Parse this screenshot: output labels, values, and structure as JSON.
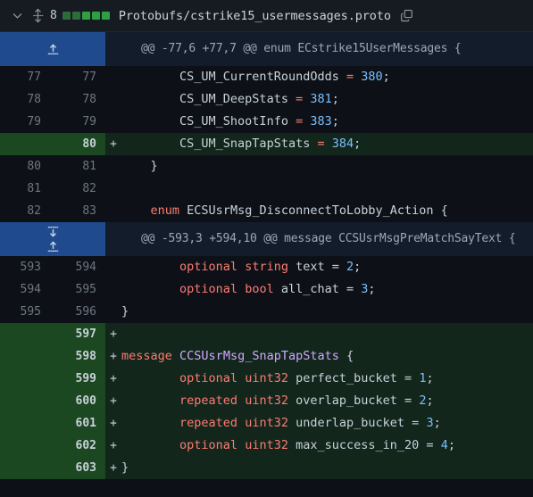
{
  "header": {
    "chevron_icon": "chevron-down-icon",
    "drag_icon": "drag-handle-icon",
    "change_count": "8",
    "diffstat_blocks": [
      "faded",
      "faded",
      "solid",
      "solid",
      "solid"
    ],
    "file_path": "Protobufs/cstrike15_usermessages.proto",
    "copy_icon": "copy-icon"
  },
  "colors": {
    "background": "#0d1117",
    "header_background": "#161b22",
    "added_gutter": "#1b4721",
    "added_code": "#12261c",
    "expander_gutter": "#1f4b8e",
    "expander_code": "#131c2b",
    "keyword": "#ff7b72",
    "number": "#79c0ff",
    "type": "#d2a8ff",
    "text": "#c9d1d9",
    "line_number": "#6e7681",
    "diffstat_added": "#2ea043"
  },
  "rows": [
    {
      "kind": "expander",
      "name": "expand-up",
      "icons": [
        "arrow-up-icon"
      ],
      "old_line": "",
      "new_line": "",
      "marker": "",
      "hunk_text": "@@ -77,6 +77,7 @@ enum ECstrike15UserMessages {"
    },
    {
      "kind": "ctx",
      "old_line": "77",
      "new_line": "77",
      "marker": "",
      "tokens": [
        {
          "t": "        ",
          "c": "pl"
        },
        {
          "t": "CS_UM_CurrentRoundOdds",
          "c": "id"
        },
        {
          "t": " ",
          "c": "pl"
        },
        {
          "t": "=",
          "c": "op"
        },
        {
          "t": " ",
          "c": "pl"
        },
        {
          "t": "380",
          "c": "num"
        },
        {
          "t": ";",
          "c": "pl"
        }
      ]
    },
    {
      "kind": "ctx",
      "old_line": "78",
      "new_line": "78",
      "marker": "",
      "tokens": [
        {
          "t": "        ",
          "c": "pl"
        },
        {
          "t": "CS_UM_DeepStats",
          "c": "id"
        },
        {
          "t": " ",
          "c": "pl"
        },
        {
          "t": "=",
          "c": "op"
        },
        {
          "t": " ",
          "c": "pl"
        },
        {
          "t": "381",
          "c": "num"
        },
        {
          "t": ";",
          "c": "pl"
        }
      ]
    },
    {
      "kind": "ctx",
      "old_line": "79",
      "new_line": "79",
      "marker": "",
      "tokens": [
        {
          "t": "        ",
          "c": "pl"
        },
        {
          "t": "CS_UM_ShootInfo",
          "c": "id"
        },
        {
          "t": " ",
          "c": "pl"
        },
        {
          "t": "=",
          "c": "op"
        },
        {
          "t": " ",
          "c": "pl"
        },
        {
          "t": "383",
          "c": "num"
        },
        {
          "t": ";",
          "c": "pl"
        }
      ]
    },
    {
      "kind": "add",
      "old_line": "",
      "new_line": "80",
      "marker": "+",
      "tokens": [
        {
          "t": "        ",
          "c": "pl"
        },
        {
          "t": "CS_UM_SnapTapStats",
          "c": "id"
        },
        {
          "t": " ",
          "c": "pl"
        },
        {
          "t": "=",
          "c": "op"
        },
        {
          "t": " ",
          "c": "pl"
        },
        {
          "t": "384",
          "c": "num"
        },
        {
          "t": ";",
          "c": "pl"
        }
      ]
    },
    {
      "kind": "ctx",
      "old_line": "80",
      "new_line": "81",
      "marker": "",
      "tokens": [
        {
          "t": "    }",
          "c": "pl"
        }
      ]
    },
    {
      "kind": "ctx",
      "old_line": "81",
      "new_line": "82",
      "marker": "",
      "tokens": [
        {
          "t": "",
          "c": "pl"
        }
      ]
    },
    {
      "kind": "ctx",
      "old_line": "82",
      "new_line": "83",
      "marker": "",
      "tokens": [
        {
          "t": "    ",
          "c": "pl"
        },
        {
          "t": "enum",
          "c": "kw"
        },
        {
          "t": " ",
          "c": "pl"
        },
        {
          "t": "ECSUsrMsg_DisconnectToLobby_Action",
          "c": "id"
        },
        {
          "t": " {",
          "c": "pl"
        }
      ]
    },
    {
      "kind": "expander",
      "name": "expand-down-up",
      "icons": [
        "arrow-down-icon",
        "arrow-up-icon"
      ],
      "old_line": "",
      "new_line": "",
      "marker": "",
      "hunk_text": "@@ -593,3 +594,10 @@ message CCSUsrMsgPreMatchSayText {"
    },
    {
      "kind": "ctx",
      "old_line": "593",
      "new_line": "594",
      "marker": "",
      "tokens": [
        {
          "t": "        ",
          "c": "pl"
        },
        {
          "t": "optional",
          "c": "kw"
        },
        {
          "t": " ",
          "c": "pl"
        },
        {
          "t": "string",
          "c": "kw"
        },
        {
          "t": " ",
          "c": "pl"
        },
        {
          "t": "text",
          "c": "id"
        },
        {
          "t": " = ",
          "c": "pl"
        },
        {
          "t": "2",
          "c": "num"
        },
        {
          "t": ";",
          "c": "pl"
        }
      ]
    },
    {
      "kind": "ctx",
      "old_line": "594",
      "new_line": "595",
      "marker": "",
      "tokens": [
        {
          "t": "        ",
          "c": "pl"
        },
        {
          "t": "optional",
          "c": "kw"
        },
        {
          "t": " ",
          "c": "pl"
        },
        {
          "t": "bool",
          "c": "kw"
        },
        {
          "t": " ",
          "c": "pl"
        },
        {
          "t": "all_chat",
          "c": "id"
        },
        {
          "t": " = ",
          "c": "pl"
        },
        {
          "t": "3",
          "c": "num"
        },
        {
          "t": ";",
          "c": "pl"
        }
      ]
    },
    {
      "kind": "ctx",
      "old_line": "595",
      "new_line": "596",
      "marker": "",
      "tokens": [
        {
          "t": "}",
          "c": "pl"
        }
      ]
    },
    {
      "kind": "add",
      "old_line": "",
      "new_line": "597",
      "marker": "+",
      "tokens": [
        {
          "t": "",
          "c": "pl"
        }
      ]
    },
    {
      "kind": "add",
      "old_line": "",
      "new_line": "598",
      "marker": "+",
      "tokens": [
        {
          "t": "message",
          "c": "kw"
        },
        {
          "t": " ",
          "c": "pl"
        },
        {
          "t": "CCSUsrMsg_SnapTapStats",
          "c": "type"
        },
        {
          "t": " {",
          "c": "pl"
        }
      ]
    },
    {
      "kind": "add",
      "old_line": "",
      "new_line": "599",
      "marker": "+",
      "tokens": [
        {
          "t": "        ",
          "c": "pl"
        },
        {
          "t": "optional",
          "c": "kw"
        },
        {
          "t": " ",
          "c": "pl"
        },
        {
          "t": "uint32",
          "c": "kw"
        },
        {
          "t": " ",
          "c": "pl"
        },
        {
          "t": "perfect_bucket",
          "c": "id"
        },
        {
          "t": " = ",
          "c": "pl"
        },
        {
          "t": "1",
          "c": "num"
        },
        {
          "t": ";",
          "c": "pl"
        }
      ]
    },
    {
      "kind": "add",
      "old_line": "",
      "new_line": "600",
      "marker": "+",
      "tokens": [
        {
          "t": "        ",
          "c": "pl"
        },
        {
          "t": "repeated",
          "c": "kw"
        },
        {
          "t": " ",
          "c": "pl"
        },
        {
          "t": "uint32",
          "c": "kw"
        },
        {
          "t": " ",
          "c": "pl"
        },
        {
          "t": "overlap_bucket",
          "c": "id"
        },
        {
          "t": " = ",
          "c": "pl"
        },
        {
          "t": "2",
          "c": "num"
        },
        {
          "t": ";",
          "c": "pl"
        }
      ]
    },
    {
      "kind": "add",
      "old_line": "",
      "new_line": "601",
      "marker": "+",
      "tokens": [
        {
          "t": "        ",
          "c": "pl"
        },
        {
          "t": "repeated",
          "c": "kw"
        },
        {
          "t": " ",
          "c": "pl"
        },
        {
          "t": "uint32",
          "c": "kw"
        },
        {
          "t": " ",
          "c": "pl"
        },
        {
          "t": "underlap_bucket",
          "c": "id"
        },
        {
          "t": " = ",
          "c": "pl"
        },
        {
          "t": "3",
          "c": "num"
        },
        {
          "t": ";",
          "c": "pl"
        }
      ]
    },
    {
      "kind": "add",
      "old_line": "",
      "new_line": "602",
      "marker": "+",
      "tokens": [
        {
          "t": "        ",
          "c": "pl"
        },
        {
          "t": "optional",
          "c": "kw"
        },
        {
          "t": " ",
          "c": "pl"
        },
        {
          "t": "uint32",
          "c": "kw"
        },
        {
          "t": " ",
          "c": "pl"
        },
        {
          "t": "max_success_in_20",
          "c": "id"
        },
        {
          "t": " = ",
          "c": "pl"
        },
        {
          "t": "4",
          "c": "num"
        },
        {
          "t": ";",
          "c": "pl"
        }
      ]
    },
    {
      "kind": "add",
      "old_line": "",
      "new_line": "603",
      "marker": "+",
      "tokens": [
        {
          "t": "}",
          "c": "pl"
        }
      ]
    }
  ]
}
